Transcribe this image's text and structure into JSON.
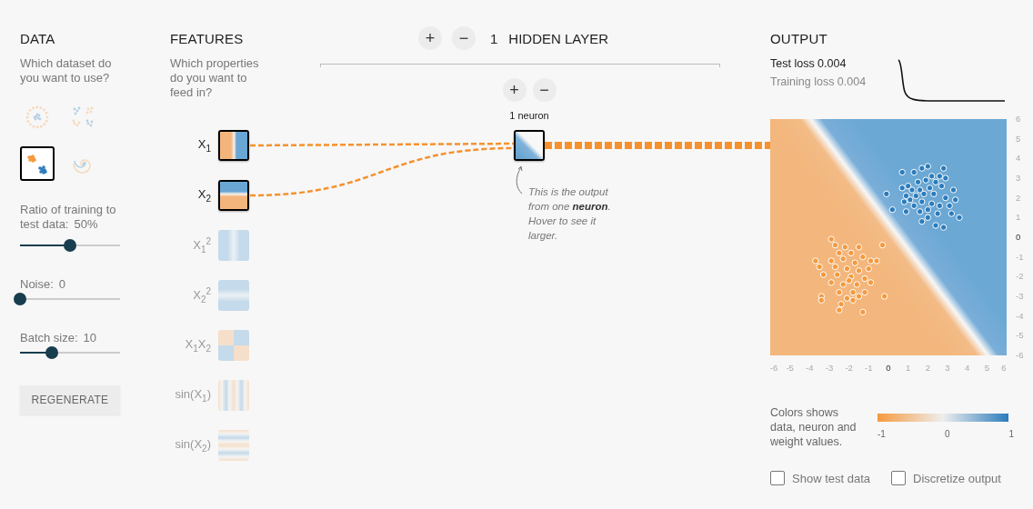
{
  "data": {
    "title": "DATA",
    "question": "Which dataset do you want to use?",
    "datasets": [
      {
        "kind": "circle",
        "selected": false
      },
      {
        "kind": "xor",
        "selected": false
      },
      {
        "kind": "gauss",
        "selected": true
      },
      {
        "kind": "spiral",
        "selected": false
      }
    ],
    "sliders": [
      {
        "label": "Ratio of training to test data:",
        "value": "50%",
        "level": 0.5
      },
      {
        "label": "Noise:",
        "value": "0",
        "level": 0
      },
      {
        "label": "Batch size:",
        "value": "10",
        "level": 0.32
      }
    ],
    "regenerate_button": "REGENERATE"
  },
  "features": {
    "title": "FEATURES",
    "question": "Which properties do you want to feed in?",
    "items": [
      {
        "label": "X$_{1}$",
        "kind": "x1",
        "selected": true
      },
      {
        "label": "X$_{2}$",
        "kind": "x2",
        "selected": true
      },
      {
        "label": "X$_{1}$$^{2}$",
        "kind": "x1sq",
        "selected": false
      },
      {
        "label": "X$_{2}$$^{2}$",
        "kind": "x2sq",
        "selected": false
      },
      {
        "label": "X$_{1}$X$_{2}$",
        "kind": "x1x2",
        "selected": false
      },
      {
        "label": "sin(X$_{1}$)",
        "kind": "sinx1",
        "selected": false
      },
      {
        "label": "sin(X$_{2}$)",
        "kind": "sinx2",
        "selected": false
      }
    ]
  },
  "hidden_layers": {
    "add_button": "+",
    "remove_button": "−",
    "count": "1",
    "title": "HIDDEN LAYER",
    "layers": [
      {
        "add_button": "+",
        "remove_button": "−",
        "neuron_count": "1 neuron"
      }
    ]
  },
  "annotation": "This is the output from one **neuron**. Hover to see it larger.",
  "output": {
    "title": "OUTPUT",
    "test_loss": "Test loss 0.004",
    "training_loss": "Training loss 0.004",
    "chart_data": {
      "type": "scatter",
      "xlim": [
        -6,
        6
      ],
      "ylim": [
        -6,
        6
      ],
      "xticks": [
        {
          "value": -6,
          "label": "-6"
        },
        {
          "value": -5,
          "label": "-5"
        },
        {
          "value": -4,
          "label": "-4"
        },
        {
          "value": -3,
          "label": "-3"
        },
        {
          "value": -2,
          "label": "-2"
        },
        {
          "value": -1,
          "label": "-1"
        },
        {
          "value": 0,
          "label": "0"
        },
        {
          "value": 1,
          "label": "1"
        },
        {
          "value": 2,
          "label": "2"
        },
        {
          "value": 3,
          "label": "3"
        },
        {
          "value": 4,
          "label": "4"
        },
        {
          "value": 5,
          "label": "5"
        },
        {
          "value": 6,
          "label": "6"
        }
      ],
      "yticks": [
        {
          "value": -6,
          "label": "-6"
        },
        {
          "value": -5,
          "label": "-5"
        },
        {
          "value": -4,
          "label": "-4"
        },
        {
          "value": -3,
          "label": "-3"
        },
        {
          "value": -2,
          "label": "-2"
        },
        {
          "value": -1,
          "label": "-1"
        },
        {
          "value": 0,
          "label": "0"
        },
        {
          "value": 1,
          "label": "1"
        },
        {
          "value": 2,
          "label": "2"
        },
        {
          "value": 3,
          "label": "3"
        },
        {
          "value": 4,
          "label": "4"
        },
        {
          "value": 5,
          "label": "5"
        },
        {
          "value": 6,
          "label": "6"
        }
      ],
      "series": [
        {
          "color": "#2b7cbc",
          "x": [
            0.7,
            1.3,
            1.7,
            2,
            2.8,
            2.2,
            2.6,
            2.9,
            1,
            1.5,
            1.9,
            2.4,
            0.7,
            1.2,
            1.6,
            2.1,
            2.7,
            3.3,
            -0.1,
            0.9,
            1.4,
            1.8,
            2.3,
            2.9,
            3.4,
            0.8,
            1.3,
            1.7,
            2.2,
            2.6,
            3.1,
            0.2,
            0.9,
            1.6,
            2,
            2.5,
            3.2,
            3.6,
            1.7,
            2.4,
            2.8,
            2,
            1.1
          ],
          "values": [
            3.3,
            3.3,
            3.5,
            3.6,
            3.5,
            3.1,
            3.1,
            3,
            2.6,
            2.8,
            2.9,
            2.8,
            2.5,
            2.4,
            2.4,
            2.5,
            2.6,
            2.4,
            2.2,
            2.1,
            2.1,
            2.2,
            2.2,
            2,
            1.9,
            1.8,
            1.6,
            1.8,
            1.7,
            1.6,
            1.6,
            1.4,
            1.3,
            1.3,
            1.4,
            1.2,
            1.2,
            1,
            0.8,
            0.6,
            0.5,
            1,
            1.9
          ]
        },
        {
          "color": "#f59a3e",
          "x": [
            -2.9,
            -2.7,
            -2.2,
            -1.5,
            -0.3,
            -2.5,
            -1.9,
            -1.3,
            -3.7,
            -2.9,
            -2.3,
            -1.7,
            -0.9,
            -0.6,
            -3.5,
            -2.7,
            -2.1,
            -1.5,
            -1,
            -3.3,
            -2.6,
            -1.9,
            -1.2,
            -2.9,
            -2.3,
            -1.6,
            -0.9,
            -2.5,
            -1.8,
            -1.2,
            -3.4,
            -2.1,
            -1.5,
            -0.2,
            -2.4,
            -1.8,
            -2.5,
            -1.3,
            -3.4,
            -2
          ],
          "values": [
            -0.1,
            -0.4,
            -0.5,
            -0.5,
            -0.4,
            -0.8,
            -0.8,
            -1,
            -1.2,
            -1.2,
            -1.1,
            -1.3,
            -1.2,
            -1.2,
            -1.5,
            -1.5,
            -1.6,
            -1.7,
            -1.6,
            -1.9,
            -1.9,
            -2,
            -2.1,
            -2.3,
            -2.4,
            -2.4,
            -2.3,
            -2.8,
            -2.8,
            -2.8,
            -3,
            -3.1,
            -3,
            -3,
            -3.4,
            -3.2,
            -3.7,
            -3.8,
            -3.2,
            -2.2
          ]
        }
      ]
    },
    "legend": {
      "text": "Colors shows data, neuron and weight values.",
      "ticks": [
        "-1",
        "0",
        "1"
      ]
    },
    "checkboxes": [
      {
        "label": "Show test data",
        "checked": false
      },
      {
        "label": "Discretize output",
        "checked": false
      }
    ]
  }
}
